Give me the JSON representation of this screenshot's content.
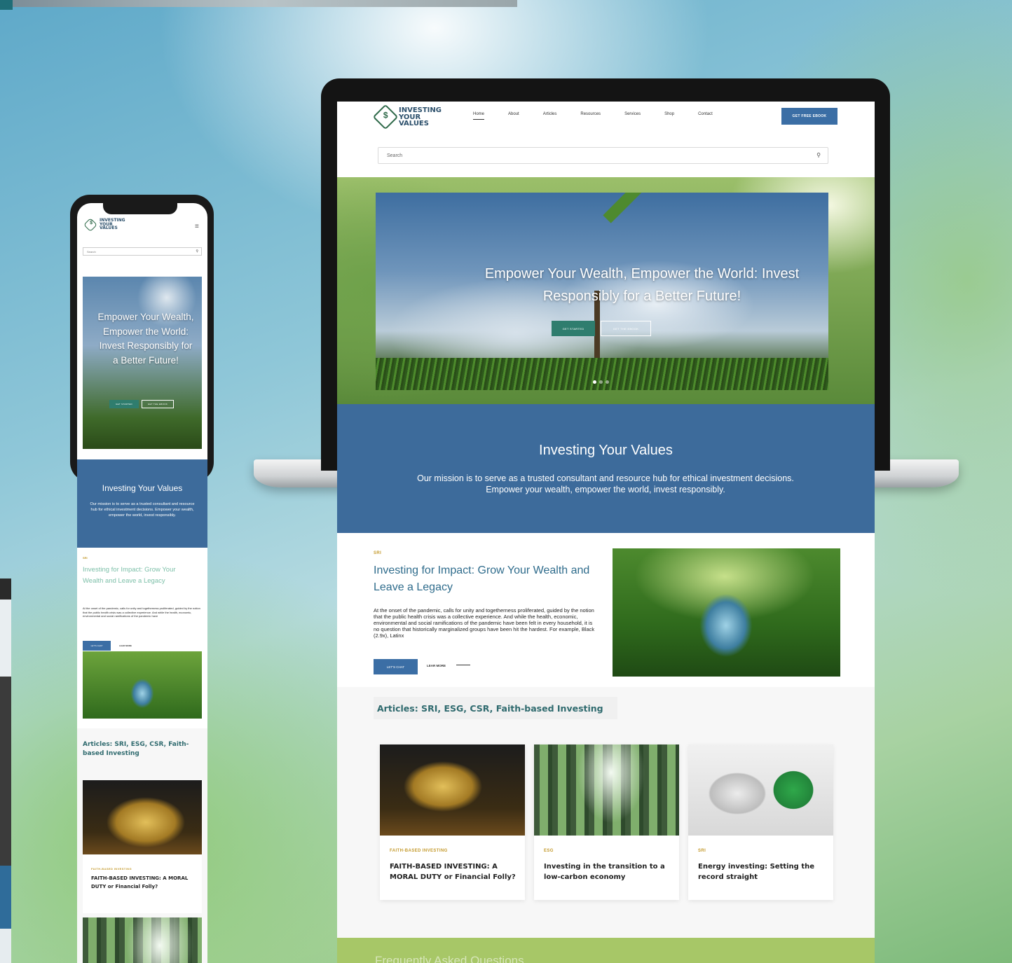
{
  "brand": {
    "logo_line1": "INVESTING",
    "logo_line2": "YOUR",
    "logo_line3": "VALUES"
  },
  "nav": {
    "items": [
      "Home",
      "About",
      "Articles",
      "Resources",
      "Services",
      "Shop",
      "Contact"
    ],
    "cta": "GET FREE EBOOK"
  },
  "search": {
    "placeholder": "Search"
  },
  "hero": {
    "title": "Empower Your Wealth, Empower the World: Invest Responsibly for a Better Future!",
    "btn_primary": "GET STARTED",
    "btn_secondary": "GET THE EBOOK"
  },
  "mission": {
    "title": "Investing Your Values",
    "text": "Our mission is to serve as a trusted consultant and resource hub for ethical investment decisions. Empower your wealth, empower the world, invest responsibly."
  },
  "feature": {
    "tag": "SRI",
    "title": "Investing for Impact: Grow Your Wealth and Leave a Legacy",
    "text": "At the onset of the pandemic, calls for unity and togetherness proliferated, guided by the notion that the public health crisis was a collective experience. And while the health, economic, environmental and social ramifications of the pandemic have been felt in every household, it is no question that historically marginalized groups have been hit the hardest. For example, Black (2.9x), Latinx",
    "mobile_text": "At the onset of the pandemic, calls for unity and togetherness proliferated, guided by the notion that the public health crisis was a collective experience. And while the health, economic, environmental and social ramifications of the pandemic have",
    "chat_btn": "LET'S CHAT",
    "learn_more": "LEAR MORE"
  },
  "articles": {
    "title": "Articles: SRI, ESG, CSR, Faith-based Investing",
    "cards": [
      {
        "tag": "FAITH-BASED INVESTING",
        "title": "FAITH-BASED INVESTING: A MORAL DUTY or Financial Folly?"
      },
      {
        "tag": "ESG",
        "title": "Investing in the transition to a low-carbon economy"
      },
      {
        "tag": "SRI",
        "title": "Energy investing: Setting the record straight"
      }
    ]
  },
  "faq": {
    "title": "Frequently Asked Questions"
  },
  "colors": {
    "primary_blue": "#3d6b9b",
    "accent_gold": "#c49a2c",
    "teal": "#2f6a6e",
    "faq_green": "#a7c767"
  }
}
